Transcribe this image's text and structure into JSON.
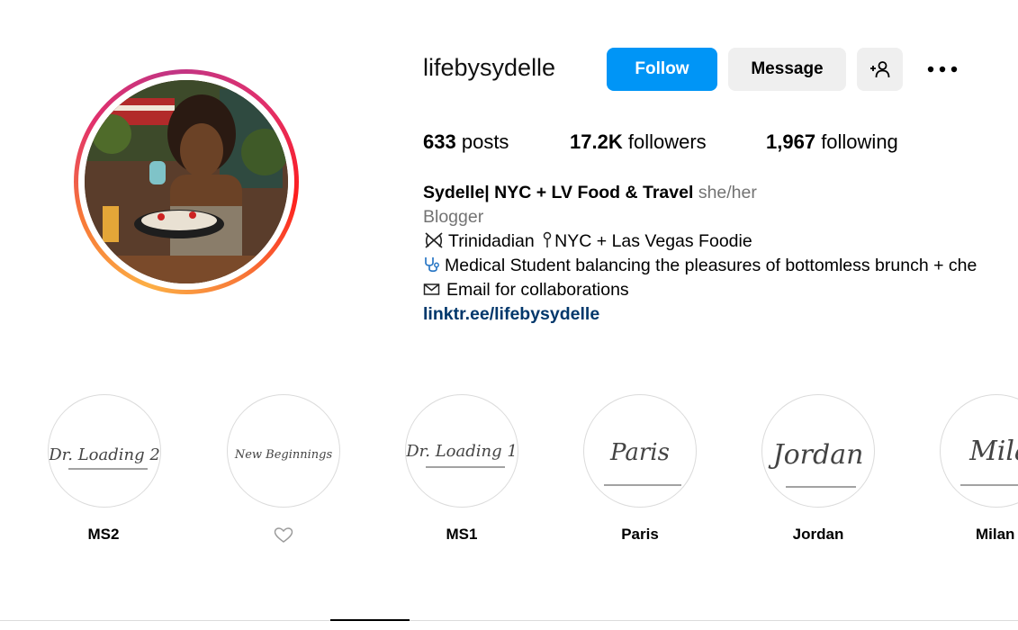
{
  "profile": {
    "username": "lifebysydelle",
    "follow_label": "Follow",
    "message_label": "Message",
    "add_user_icon": "person-add-icon",
    "more_icon": "more-options-icon",
    "avatar_icon": "profile-photo"
  },
  "stats": {
    "posts_count": "633",
    "posts_label": "posts",
    "followers_count": "17.2K",
    "followers_label": "followers",
    "following_count": "1,967",
    "following_label": "following"
  },
  "bio": {
    "name": "Sydelle| NYC + LV Food & Travel",
    "pronouns": "she/her",
    "category": "Blogger",
    "line1": "Trinidadian",
    "line1_rest": "NYC + Las Vegas Foodie",
    "line2": "Medical Student balancing the pleasures of bottomless brunch + che",
    "line3": "Email for collaborations",
    "link": "linktr.ee/lifebysydelle"
  },
  "highlights": [
    {
      "label": "MS2",
      "cover_text": "Dr. Loading 2"
    },
    {
      "label": "",
      "cover_text": "New Beginnings",
      "label_icon": "heart-icon"
    },
    {
      "label": "MS1",
      "cover_text": "Dr. Loading 1"
    },
    {
      "label": "Paris",
      "cover_text": "Paris"
    },
    {
      "label": "Jordan",
      "cover_text": "Jordan"
    },
    {
      "label": "Milan",
      "cover_text": "Mila"
    }
  ],
  "colors": {
    "follow_button": "#0095f6",
    "secondary_button": "#efefef",
    "link": "#00376b",
    "muted": "#737373"
  }
}
